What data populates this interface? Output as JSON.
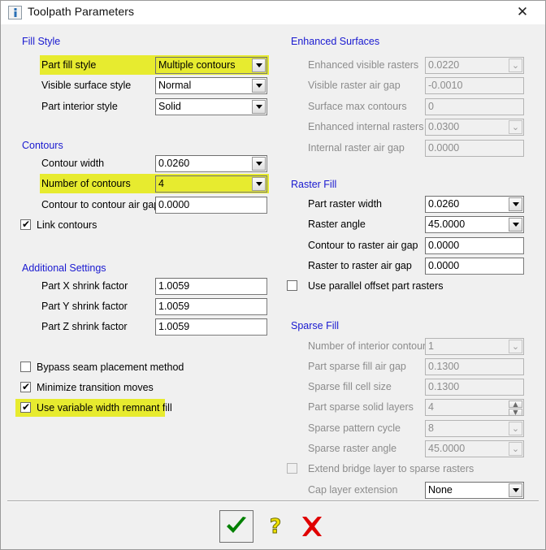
{
  "window": {
    "title": "Toolpath Parameters",
    "icon": "info-icon",
    "close_label": "✕"
  },
  "colors": {
    "highlight": "#e7eb2f",
    "group_title": "#1919d0",
    "disabled_text": "#8c8c8c",
    "ok_check": "#008000",
    "cancel_x": "#e00000",
    "help_question": "#f0e000"
  },
  "left": {
    "groups": [
      {
        "title": "Fill Style",
        "rows": [
          {
            "label": "Part fill style",
            "value": "Multiple contours",
            "control": "combo",
            "enabled": true,
            "highlight": true
          },
          {
            "label": "Visible surface style",
            "value": "Normal",
            "control": "combo",
            "enabled": true,
            "highlight": false
          },
          {
            "label": "Part interior style",
            "value": "Solid",
            "control": "combo",
            "enabled": true,
            "highlight": false
          }
        ]
      },
      {
        "title": "Contours",
        "rows": [
          {
            "label": "Contour width",
            "value": "0.0260",
            "control": "combo",
            "enabled": true,
            "highlight": false
          },
          {
            "label": "Number of contours",
            "value": "4",
            "control": "combo",
            "enabled": true,
            "highlight": true
          },
          {
            "label": "Contour to contour air gap",
            "value": "0.0000",
            "control": "text",
            "enabled": true,
            "highlight": false
          }
        ],
        "checkboxes": [
          {
            "label": "Link contours",
            "checked": true,
            "enabled": true,
            "highlight": false
          }
        ]
      },
      {
        "title": "Additional Settings",
        "rows": [
          {
            "label": "Part X shrink factor",
            "value": "1.0059",
            "control": "text",
            "enabled": true,
            "highlight": false
          },
          {
            "label": "Part Y shrink factor",
            "value": "1.0059",
            "control": "text",
            "enabled": true,
            "highlight": false
          },
          {
            "label": "Part Z shrink factor",
            "value": "1.0059",
            "control": "text",
            "enabled": true,
            "highlight": false
          }
        ],
        "checkboxes": [
          {
            "label": "Bypass seam placement method",
            "checked": false,
            "enabled": true,
            "highlight": false
          },
          {
            "label": "Minimize transition moves",
            "checked": true,
            "enabled": true,
            "highlight": false
          },
          {
            "label": "Use variable width remnant fill",
            "checked": true,
            "enabled": true,
            "highlight": true
          }
        ]
      }
    ]
  },
  "right": {
    "groups": [
      {
        "title": "Enhanced Surfaces",
        "rows": [
          {
            "label": "Enhanced visible rasters",
            "value": "0.0220",
            "control": "combo",
            "enabled": false,
            "highlight": false
          },
          {
            "label": "Visible raster air gap",
            "value": "-0.0010",
            "control": "text",
            "enabled": false,
            "highlight": false
          },
          {
            "label": "Surface max contours",
            "value": "0",
            "control": "text",
            "enabled": false,
            "highlight": false
          },
          {
            "label": "Enhanced internal rasters",
            "value": "0.0300",
            "control": "combo",
            "enabled": false,
            "highlight": false
          },
          {
            "label": "Internal raster air gap",
            "value": "0.0000",
            "control": "text",
            "enabled": false,
            "highlight": false
          }
        ]
      },
      {
        "title": "Raster Fill",
        "rows": [
          {
            "label": "Part raster width",
            "value": "0.0260",
            "control": "combo",
            "enabled": true,
            "highlight": false
          },
          {
            "label": "Raster angle",
            "value": "45.0000",
            "control": "combo",
            "enabled": true,
            "highlight": false
          },
          {
            "label": "Contour to raster air gap",
            "value": "0.0000",
            "control": "text",
            "enabled": true,
            "highlight": false
          },
          {
            "label": "Raster to raster air gap",
            "value": "0.0000",
            "control": "text",
            "enabled": true,
            "highlight": false
          }
        ],
        "checkboxes": [
          {
            "label": "Use parallel offset part rasters",
            "checked": false,
            "enabled": true,
            "highlight": false
          }
        ]
      },
      {
        "title": "Sparse Fill",
        "rows": [
          {
            "label": "Number of interior contours",
            "value": "1",
            "control": "combo",
            "enabled": false,
            "highlight": false
          },
          {
            "label": "Part sparse fill air gap",
            "value": "0.1300",
            "control": "text",
            "enabled": false,
            "highlight": false
          },
          {
            "label": "Sparse fill cell size",
            "value": "0.1300",
            "control": "text",
            "enabled": false,
            "highlight": false
          },
          {
            "label": "Part sparse solid layers",
            "value": "4",
            "control": "spin",
            "enabled": false,
            "highlight": false
          },
          {
            "label": "Sparse pattern cycle",
            "value": "8",
            "control": "combo",
            "enabled": false,
            "highlight": false
          },
          {
            "label": "Sparse raster angle",
            "value": "45.0000",
            "control": "combo",
            "enabled": false,
            "highlight": false
          }
        ],
        "checkboxes": [
          {
            "label": "Extend bridge layer to sparse rasters",
            "checked": false,
            "enabled": false,
            "highlight": false
          }
        ],
        "rows2": [
          {
            "label": "Cap layer extension",
            "value": "None",
            "control": "combo",
            "enabled": false,
            "value_enabled": true,
            "highlight": false
          }
        ]
      }
    ]
  },
  "footer": {
    "ok": {
      "name": "ok-button",
      "glyph": "✔"
    },
    "help": {
      "name": "help-button",
      "glyph": "?"
    },
    "cancel": {
      "name": "cancel-button",
      "glyph": "✖"
    }
  }
}
